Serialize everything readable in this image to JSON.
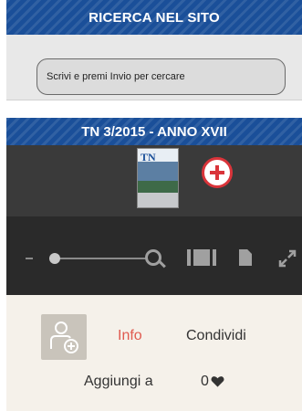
{
  "search": {
    "title": "RICERCA NEL SITO",
    "placeholder": "Scrivi e premi Invio per cercare"
  },
  "issue": {
    "title": "TN 3/2015 - ANNO XVII",
    "cover_logo": "TN"
  },
  "toolbar": {
    "zoom_out": "-",
    "zoom_level": 0
  },
  "actions": {
    "info_label": "Info",
    "share_label": "Condividi",
    "add_to_label": "Aggiungi a",
    "likes_count": "0"
  },
  "colors": {
    "header_blue": "#1a4f99",
    "accent_red": "#d9343a",
    "info_red": "#e05a4f"
  },
  "icons": [
    "zoom-plus-icon",
    "zoom-in-icon",
    "two-page-icon",
    "single-page-icon",
    "fullscreen-icon",
    "add-to-library-icon",
    "heart-icon"
  ]
}
